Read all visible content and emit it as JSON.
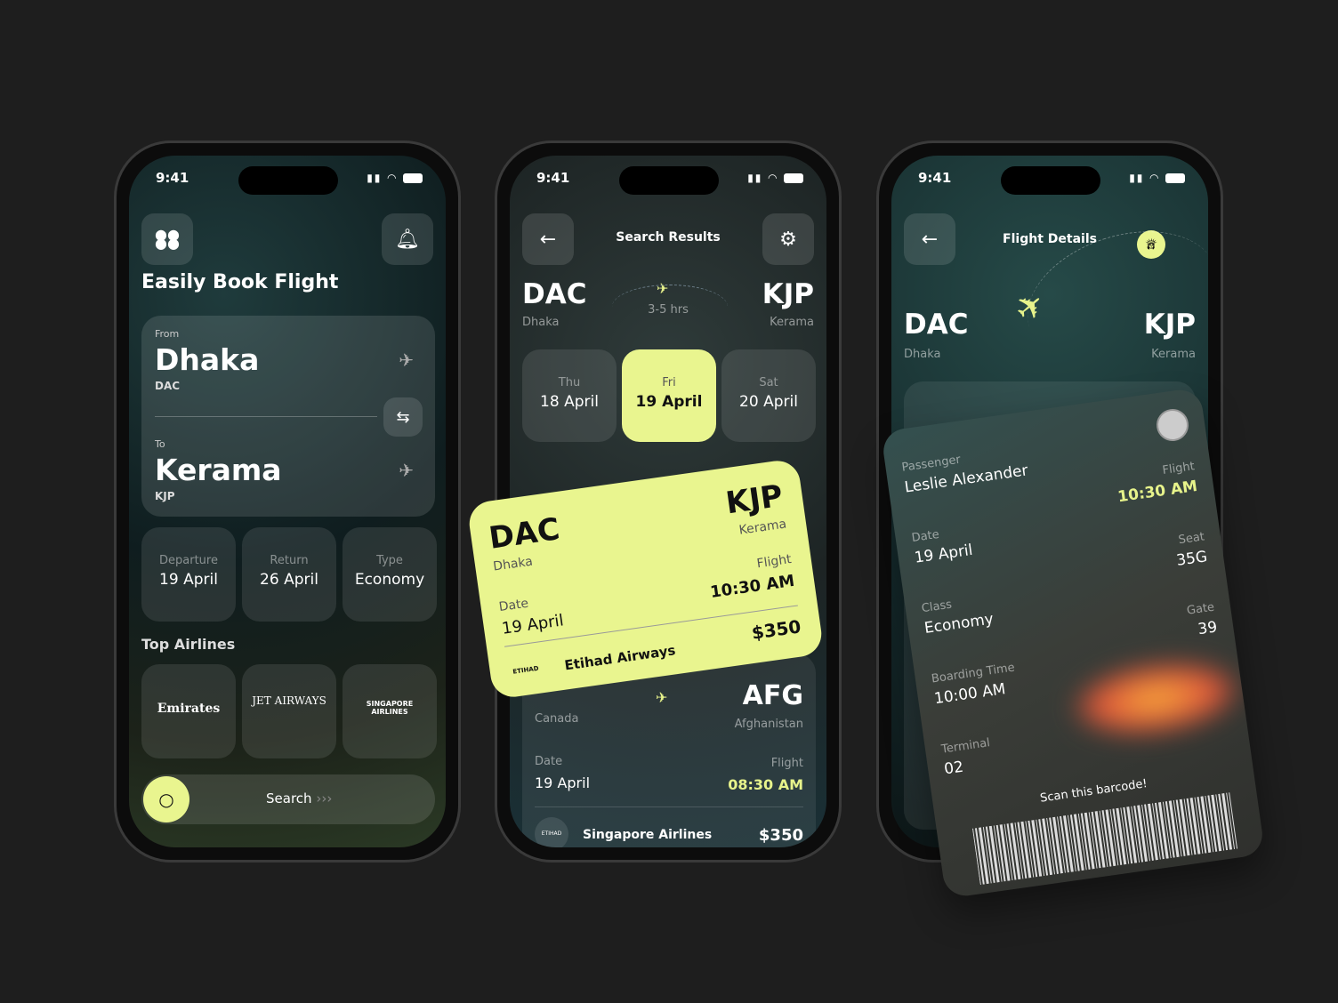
{
  "status_time": "9:41",
  "accent": "#e9f58f",
  "home": {
    "title": "Easily Book Flight",
    "menu_icon": "grid-dots-icon",
    "bell_icon": "bell-icon",
    "from": {
      "label": "From",
      "city": "Dhaka",
      "code": "DAC"
    },
    "to": {
      "label": "To",
      "city": "Kerama",
      "code": "KJP"
    },
    "options": [
      {
        "label": "Departure",
        "value": "19 April"
      },
      {
        "label": "Return",
        "value": "26 April"
      },
      {
        "label": "Type",
        "value": "Economy"
      }
    ],
    "airlines_title": "Top Airlines",
    "airlines": [
      "Emirates",
      "JET AIRWAYS",
      "SINGAPORE AIRLINES"
    ],
    "search_label": "Search"
  },
  "results": {
    "title": "Search Results",
    "from": {
      "code": "DAC",
      "city": "Dhaka"
    },
    "to": {
      "code": "KJP",
      "city": "Kerama"
    },
    "duration": "3-5 hrs",
    "days": [
      {
        "day": "Thu",
        "date": "18 April"
      },
      {
        "day": "Fri",
        "date": "19 April",
        "selected": true
      },
      {
        "day": "Sat",
        "date": "20 April"
      }
    ],
    "featured": {
      "from_code": "DAC",
      "from_city": "Dhaka",
      "to_code": "KJP",
      "to_city": "Kerama",
      "date_label": "Date",
      "date": "19 April",
      "flight_label": "Flight",
      "time": "10:30 AM",
      "airline": "Etihad Airways",
      "logo": "ETIHAD",
      "price": "$350"
    },
    "second": {
      "from_city": "Canada",
      "to_code": "AFG",
      "to_city": "Afghanistan",
      "date_label": "Date",
      "date": "19 April",
      "flight_label": "Flight",
      "time": "08:30 AM",
      "airline": "Singapore Airlines",
      "logo": "ETIHAD",
      "price": "$350"
    }
  },
  "details": {
    "title": "Flight Details",
    "from": {
      "code": "DAC",
      "city": "Dhaka"
    },
    "to": {
      "code": "KJP",
      "city": "Kerama"
    },
    "pass": {
      "passenger_label": "Passenger",
      "passenger": "Leslie Alexander",
      "date_label": "Date",
      "date": "19 April",
      "class_label": "Class",
      "class": "Economy",
      "boarding_label": "Boarding Time",
      "boarding": "10:00 AM",
      "terminal_label": "Terminal",
      "terminal": "02",
      "flight_label": "Flight",
      "flight": "10:30 AM",
      "seat_label": "Seat",
      "seat": "35G",
      "gate_label": "Gate",
      "gate": "39",
      "scan": "Scan this barcode!"
    }
  }
}
